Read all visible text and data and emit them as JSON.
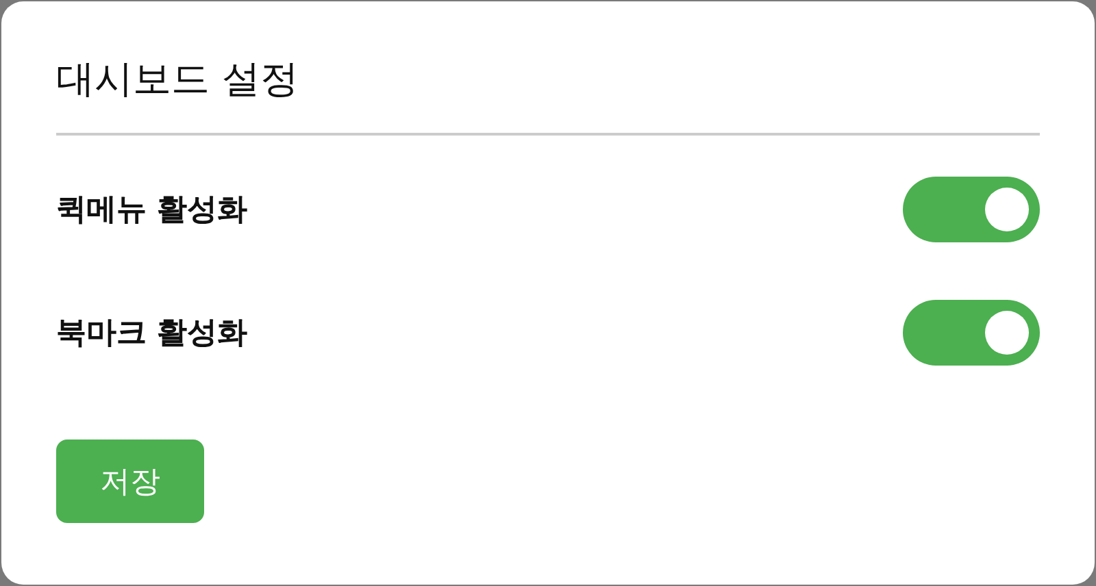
{
  "title": "대시보드 설정",
  "settings": [
    {
      "label": "퀵메뉴 활성화",
      "on": true
    },
    {
      "label": "북마크 활성화",
      "on": true
    }
  ],
  "save_button": "저장"
}
